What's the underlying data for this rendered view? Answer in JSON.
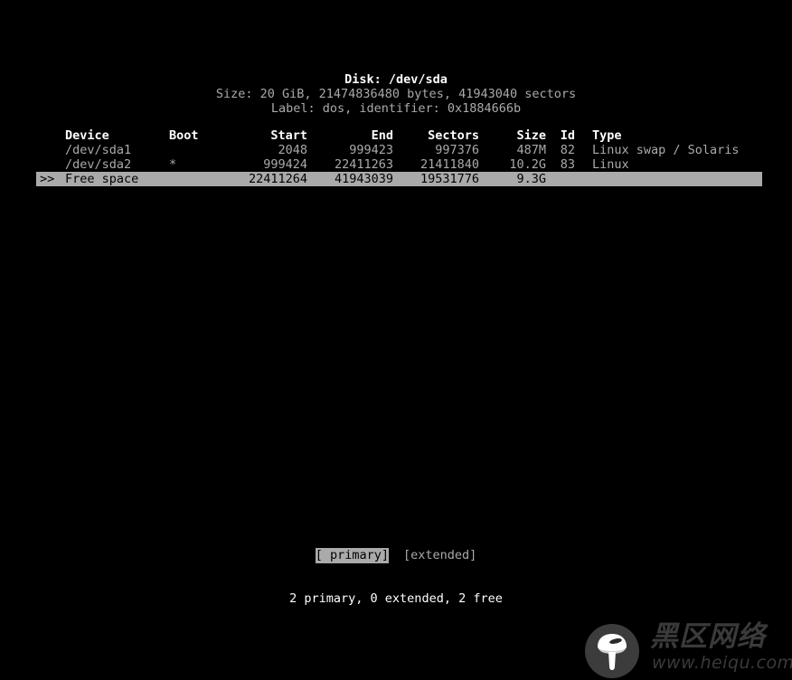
{
  "terminal": {
    "disk_title": "Disk: /dev/sda",
    "size_line": "Size: 20 GiB, 21474836480 bytes, 41943040 sectors",
    "label_line": "Label: dos, identifier: 0x1884666b"
  },
  "table": {
    "headers": {
      "device": "Device",
      "boot": "Boot",
      "start": "Start",
      "end": "End",
      "sectors": "Sectors",
      "size": "Size",
      "id": "Id",
      "type": "Type"
    },
    "rows": [
      {
        "marker": "",
        "device": "/dev/sda1",
        "boot": "",
        "start": "2048",
        "end": "999423",
        "sectors": "997376",
        "size": "487M",
        "id": "82",
        "type": "Linux swap / Solaris",
        "selected": false
      },
      {
        "marker": "",
        "device": "/dev/sda2",
        "boot": "*",
        "start": "999424",
        "end": "22411263",
        "sectors": "21411840",
        "size": "10.2G",
        "id": "83",
        "type": "Linux",
        "selected": false
      },
      {
        "marker": ">>",
        "device": "Free space",
        "boot": "",
        "start": "22411264",
        "end": "41943039",
        "sectors": "19531776",
        "size": "9.3G",
        "id": "",
        "type": "",
        "selected": true
      }
    ]
  },
  "menu": {
    "primary_label": "[ primary]",
    "extended_label": "[extended]",
    "selected": "primary"
  },
  "status": {
    "summary": "2 primary, 0 extended, 2 free"
  },
  "watermark": {
    "site_name_cn": "黑区网络",
    "url": "www.heiqu.com"
  },
  "colors": {
    "background": "#000000",
    "bright_text": "#ffffff",
    "normal_text": "#aaaaaa",
    "highlight_bg": "#aaaaaa",
    "highlight_fg": "#000000",
    "watermark": "#3a3a3a"
  }
}
